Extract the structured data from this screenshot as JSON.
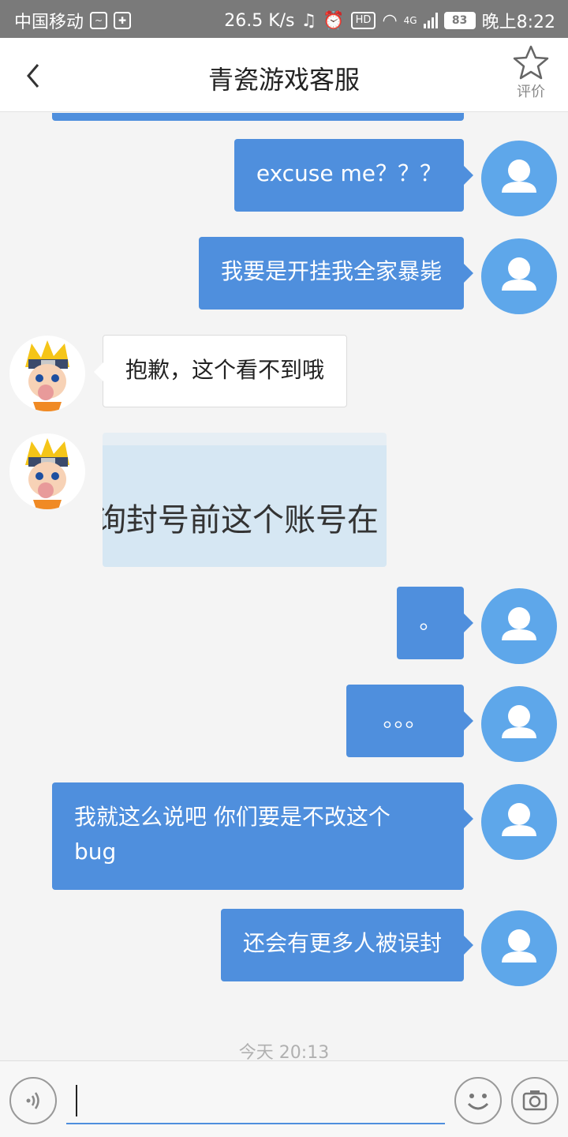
{
  "status_bar": {
    "carrier": "中国移动",
    "speed": "26.5 K/s",
    "network": "4G",
    "battery": "83",
    "time": "晚上8:22"
  },
  "header": {
    "title": "青瓷游戏客服",
    "rate_label": "评价"
  },
  "messages": [
    {
      "from": "user",
      "text": "excuse me？？？"
    },
    {
      "from": "user",
      "text": "我要是开挂我全家暴毙"
    },
    {
      "from": "agent",
      "text": "抱歉，这个看不到哦"
    },
    {
      "from": "agent",
      "type": "image",
      "image_text": "询封号前这个账号在"
    },
    {
      "from": "user",
      "text": "。"
    },
    {
      "from": "user",
      "text": "。。。"
    },
    {
      "from": "user",
      "text_line1": "我就这么说吧 你们要是不改这个",
      "text_line2": "bug"
    },
    {
      "from": "user",
      "text": "还会有更多人被误封"
    }
  ],
  "timestamp": "今天 20:13",
  "input": {
    "value": "",
    "voice_icon": "voice-icon",
    "emoji_icon": "emoji-icon",
    "camera_icon": "camera-icon"
  },
  "colors": {
    "user_bubble": "#4f8fdd",
    "user_avatar": "#5ea7ea",
    "status_bar": "#7a7a7a"
  }
}
